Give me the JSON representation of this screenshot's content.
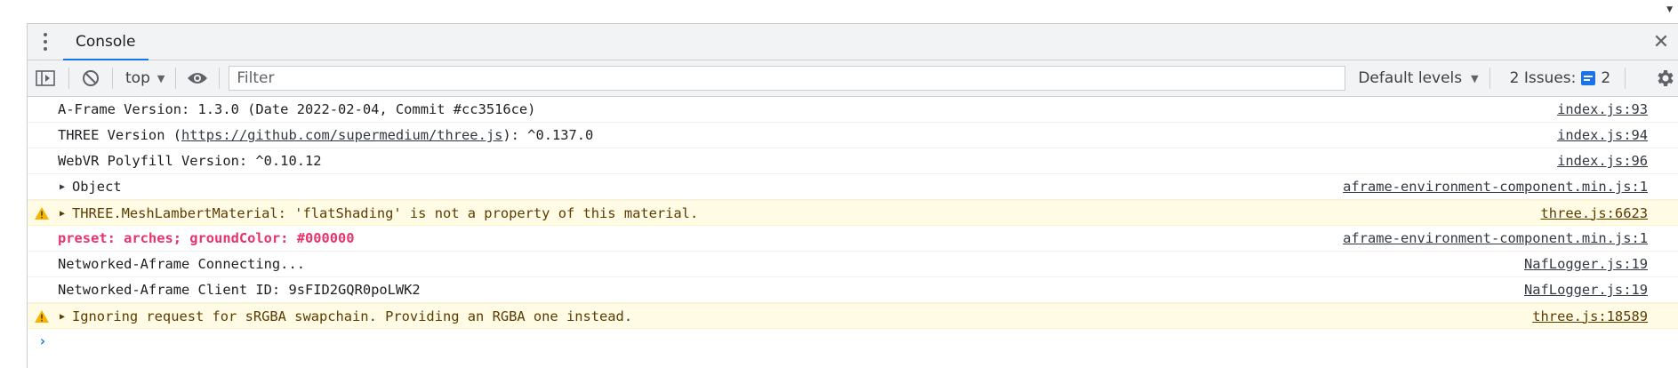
{
  "tabs": [
    {
      "label": "Console",
      "active": true
    }
  ],
  "toolbar": {
    "context": "top",
    "filter_placeholder": "Filter",
    "levels": "Default levels",
    "issues_label": "2 Issues:",
    "issues_count": "2"
  },
  "icons": {
    "kebab": "more-vertical-icon",
    "close": "close-icon",
    "sidebar": "sidebar-toggle-icon",
    "clear": "clear-console-icon",
    "eye": "live-expression-icon",
    "issue": "issue-message-icon",
    "gear": "settings-icon",
    "warning": "warning-icon"
  },
  "colors": {
    "accent": "#1a73e8",
    "warning_bg": "#fffbe5",
    "warning_text": "#5c3c00",
    "styled_log": "#e8336c"
  },
  "messages": [
    {
      "level": "log",
      "text": "A-Frame Version: 1.3.0 (Date 2022-02-04, Commit #cc3516ce)",
      "source": "index.js:93"
    },
    {
      "level": "log",
      "text_before": "THREE Version (",
      "link": "https://github.com/supermedium/three.js",
      "text_after": "): ^0.137.0",
      "source": "index.js:94"
    },
    {
      "level": "log",
      "text": "WebVR Polyfill Version: ^0.10.12",
      "source": "index.js:96"
    },
    {
      "level": "log",
      "text": "Object",
      "expandable": true,
      "source": "aframe-environment-component.min.js:1"
    },
    {
      "level": "warning",
      "text": "THREE.MeshLambertMaterial: 'flatShading' is not a property of this material.",
      "expandable": true,
      "source": "three.js:6623"
    },
    {
      "level": "log",
      "text": "preset: arches; groundColor: #000000",
      "styled": true,
      "source": "aframe-environment-component.min.js:1"
    },
    {
      "level": "log",
      "text": "Networked-Aframe Connecting...",
      "source": "NafLogger.js:19"
    },
    {
      "level": "log",
      "text": "Networked-Aframe Client ID: 9sFID2GQR0poLWK2",
      "source": "NafLogger.js:19"
    },
    {
      "level": "warning",
      "text": "Ignoring request for sRGBA swapchain. Providing an RGBA one instead.",
      "expandable": true,
      "source": "three.js:18589"
    }
  ],
  "prompt": "›"
}
